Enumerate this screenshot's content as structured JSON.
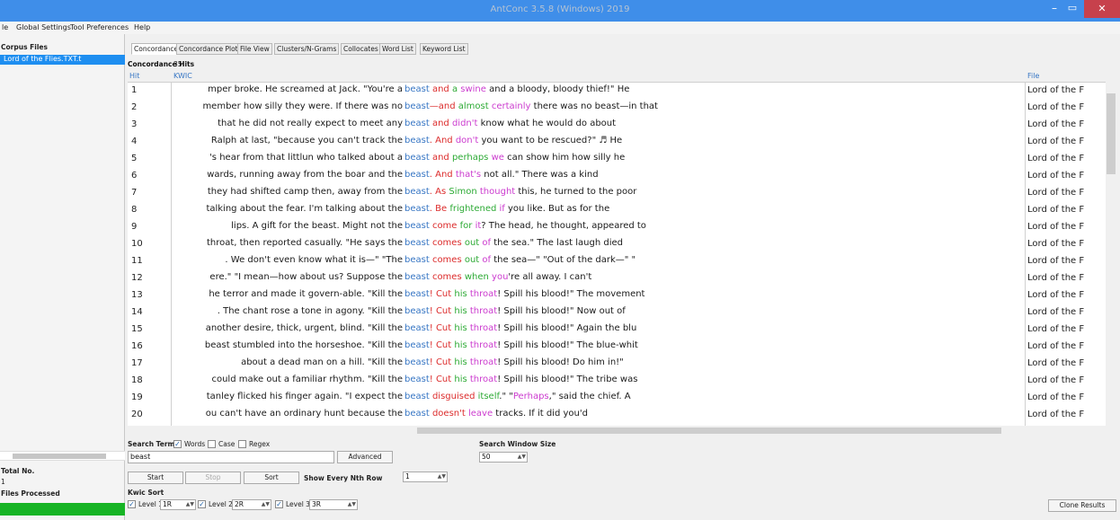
{
  "window": {
    "title": "AntConc 3.5.8 (Windows) 2019",
    "min": "–",
    "max": "▭",
    "close": "✕"
  },
  "menu": [
    "le",
    "Global Settings",
    "Tool Preferences",
    "Help"
  ],
  "left_panel": {
    "corpus_files_label": "Corpus Files",
    "corpus_file": "Lord of the Flies.TXT.t",
    "total_no_label": "Total No.",
    "total_no_value": "1",
    "files_processed_label": "Files Processed"
  },
  "tabs": [
    "Concordance",
    "Concordance Plot",
    "File View",
    "Clusters/N-Grams",
    "Collocates",
    "Word List",
    "Keyword List"
  ],
  "concordance": {
    "hits_label": "Concordance Hits",
    "hits_count": "35",
    "col_hit": "Hit",
    "col_kwic": "KWIC",
    "col_file": "File",
    "rows": [
      {
        "hit": "1",
        "left": "mper broke. He screamed at Jack. \"You're a",
        "kw": "beast",
        "r": [
          {
            "t": " and ",
            "c": "red"
          },
          {
            "t": "a ",
            "c": "green"
          },
          {
            "t": "swine",
            "c": "pink"
          },
          {
            "t": " and a bloody, bloody thief!\" He",
            "c": ""
          }
        ],
        "file": "Lord of the F"
      },
      {
        "hit": "2",
        "left": "member how silly they were. If there was no",
        "kw": "beast",
        "r": [
          {
            "t": "—and ",
            "c": "red"
          },
          {
            "t": "almost ",
            "c": "green"
          },
          {
            "t": "certainly",
            "c": "pink"
          },
          {
            "t": " there was no beast—in that",
            "c": ""
          }
        ],
        "file": "Lord of the F"
      },
      {
        "hit": "3",
        "left": "that he did not really expect to meet any",
        "kw": "beast",
        "r": [
          {
            "t": " and ",
            "c": "red"
          },
          {
            "t": "didn't",
            "c": "pink"
          },
          {
            "t": " know what he would do about",
            "c": ""
          }
        ],
        "file": "Lord of the F"
      },
      {
        "hit": "4",
        "left": "Ralph at last, \"because you can't track the",
        "kw": "beast",
        "r": [
          {
            "t": ". And ",
            "c": "red"
          },
          {
            "t": "don't",
            "c": "pink"
          },
          {
            "t": " you want to be rescued?\" ♬ He",
            "c": ""
          }
        ],
        "file": "Lord of the F"
      },
      {
        "hit": "5",
        "left": "'s hear from that littlun who talked about a",
        "kw": "beast",
        "r": [
          {
            "t": " and ",
            "c": "red"
          },
          {
            "t": "perhaps ",
            "c": "green"
          },
          {
            "t": "we",
            "c": "pink"
          },
          {
            "t": " can show him how silly he",
            "c": ""
          }
        ],
        "file": "Lord of the F"
      },
      {
        "hit": "6",
        "left": "wards, running away from the boar and the",
        "kw": "beast",
        "r": [
          {
            "t": ". And ",
            "c": "red"
          },
          {
            "t": "that's",
            "c": "pink"
          },
          {
            "t": " not all.\" There was a kind",
            "c": ""
          }
        ],
        "file": "Lord of the F"
      },
      {
        "hit": "7",
        "left": "they had shifted camp then, away from the",
        "kw": "beast",
        "r": [
          {
            "t": ". As ",
            "c": "red"
          },
          {
            "t": "Simon ",
            "c": "green"
          },
          {
            "t": "thought",
            "c": "pink"
          },
          {
            "t": " this, he turned to the poor",
            "c": ""
          }
        ],
        "file": "Lord of the F"
      },
      {
        "hit": "8",
        "left": "talking about the fear. I'm talking about the",
        "kw": "beast",
        "r": [
          {
            "t": ". Be ",
            "c": "red"
          },
          {
            "t": "frightened ",
            "c": "green"
          },
          {
            "t": "if",
            "c": "pink"
          },
          {
            "t": " you like. But as for the",
            "c": ""
          }
        ],
        "file": "Lord of the F"
      },
      {
        "hit": "9",
        "left": "lips. A gift for the beast. Might not the",
        "kw": "beast",
        "r": [
          {
            "t": " come ",
            "c": "red"
          },
          {
            "t": "for ",
            "c": "green"
          },
          {
            "t": "it",
            "c": "pink"
          },
          {
            "t": "? The head, he thought, appeared to",
            "c": ""
          }
        ],
        "file": "Lord of the F"
      },
      {
        "hit": "10",
        "left": "throat, then reported casually. \"He says the",
        "kw": "beast",
        "r": [
          {
            "t": " comes ",
            "c": "red"
          },
          {
            "t": "out ",
            "c": "green"
          },
          {
            "t": "of",
            "c": "pink"
          },
          {
            "t": " the sea.\" The last laugh died",
            "c": ""
          }
        ],
        "file": "Lord of the F"
      },
      {
        "hit": "11",
        "left": ". We don't even know what it is—\" \"The",
        "kw": "beast",
        "r": [
          {
            "t": " comes ",
            "c": "red"
          },
          {
            "t": "out ",
            "c": "green"
          },
          {
            "t": "of",
            "c": "pink"
          },
          {
            "t": " the sea—\" \"Out of the dark—\" \"",
            "c": ""
          }
        ],
        "file": "Lord of the F"
      },
      {
        "hit": "12",
        "left": "ere.\" \"I mean—how about us? Suppose the",
        "kw": "beast",
        "r": [
          {
            "t": " comes ",
            "c": "red"
          },
          {
            "t": "when ",
            "c": "green"
          },
          {
            "t": "you",
            "c": "pink"
          },
          {
            "t": "'re all away. I can't",
            "c": ""
          }
        ],
        "file": "Lord of the F"
      },
      {
        "hit": "13",
        "left": "he terror and made it govern-able. \"Kill the",
        "kw": "beast",
        "r": [
          {
            "t": "! Cut ",
            "c": "red"
          },
          {
            "t": "his ",
            "c": "green"
          },
          {
            "t": "throat",
            "c": "pink"
          },
          {
            "t": "! Spill his blood!\" The movement",
            "c": ""
          }
        ],
        "file": "Lord of the F"
      },
      {
        "hit": "14",
        "left": ". The chant rose a tone in agony. \"Kill the",
        "kw": "beast",
        "r": [
          {
            "t": "! Cut ",
            "c": "red"
          },
          {
            "t": "his ",
            "c": "green"
          },
          {
            "t": "throat",
            "c": "pink"
          },
          {
            "t": "! Spill his blood!\" Now out of",
            "c": ""
          }
        ],
        "file": "Lord of the F"
      },
      {
        "hit": "15",
        "left": "another desire, thick, urgent, blind. \"Kill the",
        "kw": "beast",
        "r": [
          {
            "t": "! Cut ",
            "c": "red"
          },
          {
            "t": "his ",
            "c": "green"
          },
          {
            "t": "throat",
            "c": "pink"
          },
          {
            "t": "! Spill his blood!\" Again the blu",
            "c": ""
          }
        ],
        "file": "Lord of the F"
      },
      {
        "hit": "16",
        "left": "beast stumbled into the horseshoe. \"Kill the",
        "kw": "beast",
        "r": [
          {
            "t": "! Cut ",
            "c": "red"
          },
          {
            "t": "his ",
            "c": "green"
          },
          {
            "t": "throat",
            "c": "pink"
          },
          {
            "t": "! Spill his blood!\" The blue-whit",
            "c": ""
          }
        ],
        "file": "Lord of the F"
      },
      {
        "hit": "17",
        "left": "about a dead man on a hill. \"Kill the",
        "kw": "beast",
        "r": [
          {
            "t": "! Cut ",
            "c": "red"
          },
          {
            "t": "his ",
            "c": "green"
          },
          {
            "t": "throat",
            "c": "pink"
          },
          {
            "t": "! Spill his blood! Do him in!\"",
            "c": ""
          }
        ],
        "file": "Lord of the F"
      },
      {
        "hit": "18",
        "left": "could make out a familiar rhythm. \"Kill the",
        "kw": "beast",
        "r": [
          {
            "t": "! Cut ",
            "c": "red"
          },
          {
            "t": "his ",
            "c": "green"
          },
          {
            "t": "throat",
            "c": "pink"
          },
          {
            "t": "! Spill his blood!\" The tribe was",
            "c": ""
          }
        ],
        "file": "Lord of the F"
      },
      {
        "hit": "19",
        "left": "tanley flicked his finger again. \"I expect the",
        "kw": "beast",
        "r": [
          {
            "t": " disguised ",
            "c": "red"
          },
          {
            "t": "itself",
            "c": "green"
          },
          {
            "t": ".\" \"",
            "c": ""
          },
          {
            "t": "Perhaps",
            "c": "pink"
          },
          {
            "t": ",\" said the chief. A",
            "c": ""
          }
        ],
        "file": "Lord of the F"
      },
      {
        "hit": "20",
        "left": "ou can't have an ordinary hunt because the",
        "kw": "beast",
        "r": [
          {
            "t": " doesn't ",
            "c": "red"
          },
          {
            "t": "leave",
            "c": "pink"
          },
          {
            "t": " tracks. If it did you'd",
            "c": ""
          }
        ],
        "file": "Lord of the F"
      }
    ]
  },
  "search": {
    "term_label": "Search Term",
    "words_label": "Words",
    "case_label": "Case",
    "regex_label": "Regex",
    "term_value": "beast",
    "advanced_label": "Advanced",
    "window_size_label": "Search Window Size",
    "window_size_value": "50",
    "start_label": "Start",
    "stop_label": "Stop",
    "sort_label": "Sort",
    "nth_row_label": "Show Every Nth Row",
    "nth_row_value": "1",
    "kwic_sort_label": "Kwic Sort",
    "level1_label": "Level 1",
    "level1_value": "1R",
    "level2_label": "Level 2",
    "level2_value": "2R",
    "level3_label": "Level 3",
    "level3_value": "3R",
    "clone_label": "Clone Results"
  },
  "colors": {
    "keyword": "#3776c4",
    "red": "#dc2b2b",
    "green": "#2daa35",
    "pink": "#cc3ccf",
    "titlebar": "#3f8ee9",
    "progress": "#17b425"
  }
}
